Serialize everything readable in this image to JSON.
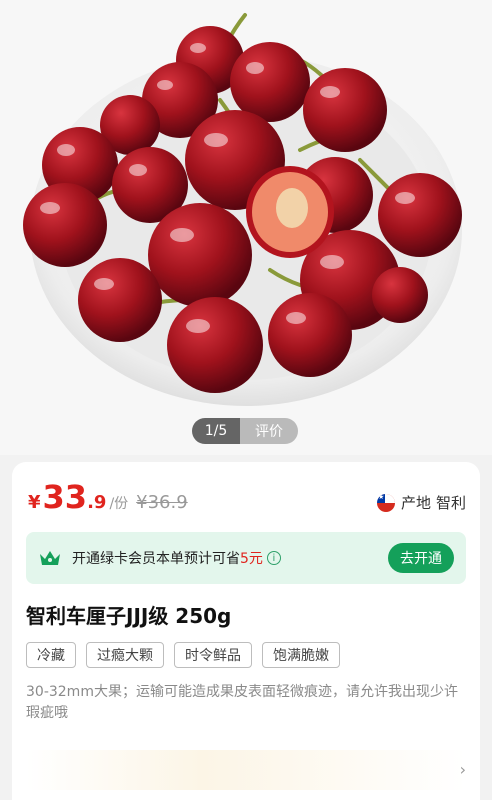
{
  "gallery": {
    "page_indicator": "1/5",
    "review_tab": "评价"
  },
  "price": {
    "currency": "¥",
    "integer": "33",
    "decimal": ".9",
    "unit": "/份",
    "original": "¥36.9"
  },
  "origin": {
    "label": "产地",
    "country": "智利",
    "flag_icon": "chile-flag-icon"
  },
  "membership": {
    "text_before": "开通绿卡会员本单预计可省",
    "amount": "5元",
    "button_label": "去开通",
    "icon": "crown-icon"
  },
  "product": {
    "title": "智利车厘子JJJ级 250g",
    "tags": [
      "冷藏",
      "过瘾大颗",
      "时令鲜品",
      "饱满脆嫩"
    ],
    "description": "30-32mm大果；运输可能造成果皮表面轻微痕迹，请允许我出现少许瑕疵哦"
  },
  "colors": {
    "price_red": "#e0241e",
    "brand_green": "#14a05a",
    "member_bg": "#e3f6ec"
  }
}
